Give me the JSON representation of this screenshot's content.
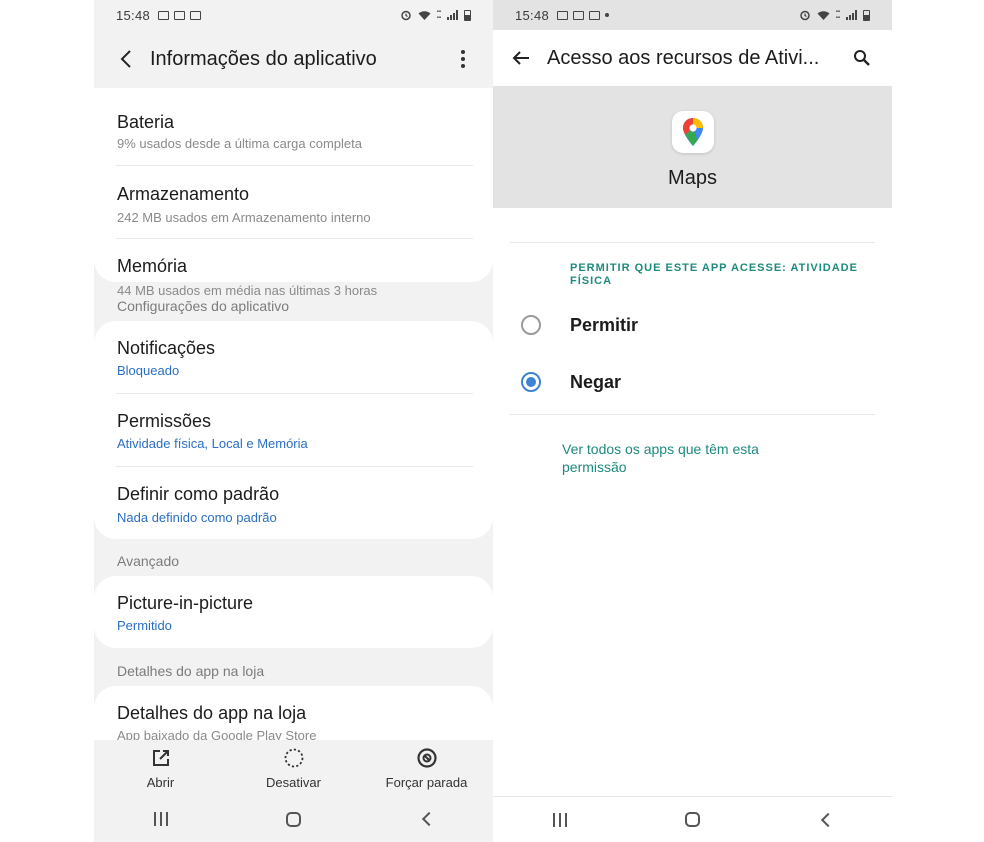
{
  "left": {
    "status": {
      "time": "15:48"
    },
    "appbar": {
      "title": "Informações do aplicativo"
    },
    "top_card": {
      "partial_title": "Bateria",
      "partial_subtitle": "9% usados desde a última carga completa",
      "items": [
        {
          "title": "Armazenamento",
          "subtitle": "242 MB usados em Armazenamento interno"
        },
        {
          "title": "Memória",
          "subtitle": "44 MB usados em média nas últimas 3 horas"
        }
      ]
    },
    "section_config": "Configurações do aplicativo",
    "config_items": [
      {
        "title": "Notificações",
        "subtitle": "Bloqueado"
      },
      {
        "title": "Permissões",
        "subtitle": "Atividade física, Local e Memória"
      },
      {
        "title": "Definir como padrão",
        "subtitle": "Nada definido como padrão"
      }
    ],
    "section_advanced": "Avançado",
    "advanced_items": [
      {
        "title": "Picture-in-picture",
        "subtitle": "Permitido"
      }
    ],
    "section_store": "Detalhes do app na loja",
    "store_items": [
      {
        "title": "Detalhes do app na loja",
        "subtitle": "App baixado da Google Play Store"
      }
    ],
    "actions": [
      {
        "label": "Abrir",
        "icon": "open-external-icon"
      },
      {
        "label": "Desativar",
        "icon": "disable-dotted-circle-icon"
      },
      {
        "label": "Forçar parada",
        "icon": "force-stop-icon"
      }
    ]
  },
  "right": {
    "status": {
      "time": "15:48"
    },
    "appbar": {
      "title": "Acesso aos recursos de Ativi..."
    },
    "app": {
      "name": "Maps",
      "icon": "google-maps-pin-icon"
    },
    "permission_header": "PERMITIR QUE ESTE APP ACESSE: ATIVIDADE FÍSICA",
    "options": [
      {
        "label": "Permitir",
        "checked": false
      },
      {
        "label": "Negar",
        "checked": true
      }
    ],
    "see_all_link": "Ver todos os apps que têm esta permissão"
  },
  "colors": {
    "accent_blue": "#2a6fc4",
    "teal": "#1e8a7e",
    "radio_blue": "#3e82d6",
    "left_background": "#f2f2f2",
    "right_header_gray": "#e3e3e3"
  }
}
